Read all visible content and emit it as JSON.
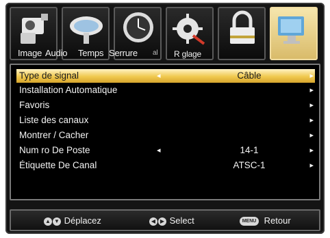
{
  "tabs": [
    {
      "label": "Image",
      "icon": "camera-icon"
    },
    {
      "label": "Audio",
      "icon": "satellite-dish-icon"
    },
    {
      "label": "Temps",
      "icon": "clock-icon"
    },
    {
      "label": "Serrure",
      "icon": "settings-gear-icon"
    },
    {
      "label": "al",
      "icon": "padlock-icon"
    },
    {
      "label": "R glage",
      "icon": "monitor-icon"
    }
  ],
  "menu": {
    "rows": [
      {
        "label": "Type de signal",
        "value": "Câble",
        "left_arrow": "◂",
        "right_arrow": "▸"
      },
      {
        "label": "Installation Automatique",
        "value": "",
        "left_arrow": "",
        "right_arrow": "▸"
      },
      {
        "label": "Favoris",
        "value": "",
        "left_arrow": "",
        "right_arrow": "▸"
      },
      {
        "label": "Liste des canaux",
        "value": "",
        "left_arrow": "",
        "right_arrow": "▸"
      },
      {
        "label": "Montrer / Cacher",
        "value": "",
        "left_arrow": "",
        "right_arrow": "▸"
      },
      {
        "label": "Num  ro De Poste",
        "value": "14-1",
        "left_arrow": "◂",
        "right_arrow": "▸"
      },
      {
        "label": "Étiquette De Canal",
        "value": "ATSC-1",
        "left_arrow": "",
        "right_arrow": "▸"
      }
    ]
  },
  "footer": {
    "move_label": "Déplacez",
    "select_label": "Select",
    "menu_key": "MENU",
    "return_label": "Retour"
  },
  "colors": {
    "highlight": "#f0c94f",
    "active_tab": "#f6e6ad",
    "background": "#000000"
  }
}
